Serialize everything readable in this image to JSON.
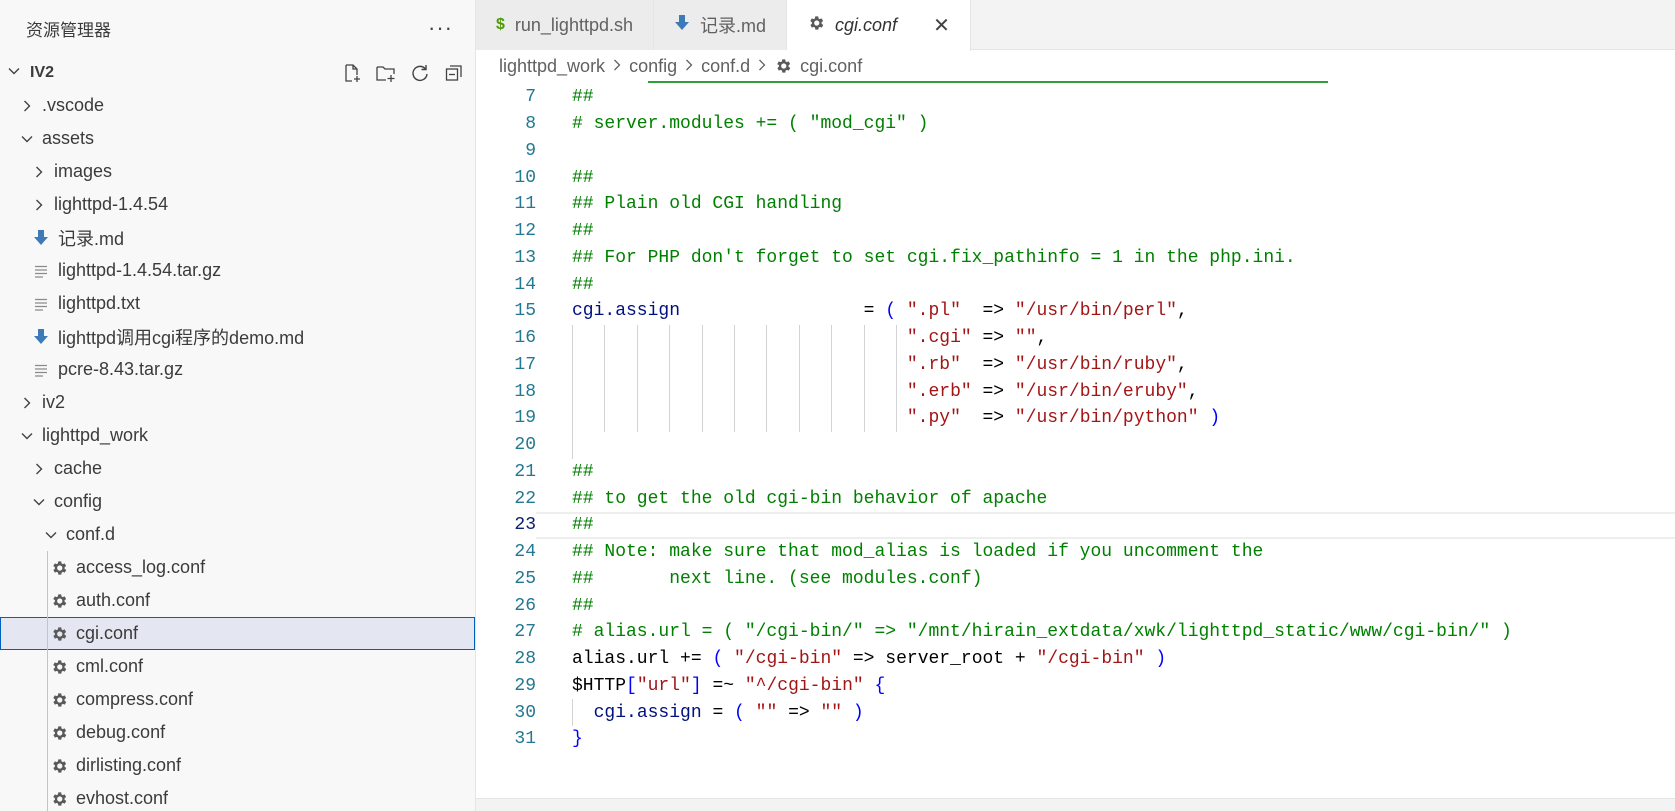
{
  "sidebar": {
    "title": "资源管理器",
    "more": "···",
    "root_label": "IV2",
    "items": [
      {
        "label": ".vscode",
        "type": "folder",
        "expanded": false,
        "depth": 1
      },
      {
        "label": "assets",
        "type": "folder",
        "expanded": true,
        "depth": 1
      },
      {
        "label": "images",
        "type": "folder",
        "expanded": false,
        "depth": 2
      },
      {
        "label": "lighttpd-1.4.54",
        "type": "folder",
        "expanded": false,
        "depth": 2
      },
      {
        "label": "记录.md",
        "type": "markdown",
        "depth": 2
      },
      {
        "label": "lighttpd-1.4.54.tar.gz",
        "type": "text",
        "depth": 2
      },
      {
        "label": "lighttpd.txt",
        "type": "text",
        "depth": 2
      },
      {
        "label": "lighttpd调用cgi程序的demo.md",
        "type": "markdown",
        "depth": 2
      },
      {
        "label": "pcre-8.43.tar.gz",
        "type": "text",
        "depth": 2
      },
      {
        "label": "iv2",
        "type": "folder",
        "expanded": false,
        "depth": 1
      },
      {
        "label": "lighttpd_work",
        "type": "folder",
        "expanded": true,
        "depth": 1
      },
      {
        "label": "cache",
        "type": "folder",
        "expanded": false,
        "depth": 2
      },
      {
        "label": "config",
        "type": "folder",
        "expanded": true,
        "depth": 2
      },
      {
        "label": "conf.d",
        "type": "folder",
        "expanded": true,
        "depth": 3
      },
      {
        "label": "access_log.conf",
        "type": "conf",
        "depth": 4
      },
      {
        "label": "auth.conf",
        "type": "conf",
        "depth": 4
      },
      {
        "label": "cgi.conf",
        "type": "conf",
        "depth": 4,
        "selected": true
      },
      {
        "label": "cml.conf",
        "type": "conf",
        "depth": 4
      },
      {
        "label": "compress.conf",
        "type": "conf",
        "depth": 4
      },
      {
        "label": "debug.conf",
        "type": "conf",
        "depth": 4
      },
      {
        "label": "dirlisting.conf",
        "type": "conf",
        "depth": 4
      },
      {
        "label": "evhost.conf",
        "type": "conf",
        "depth": 4
      }
    ]
  },
  "tabs": [
    {
      "label": "run_lighttpd.sh",
      "icon": "dollar-icon",
      "active": false
    },
    {
      "label": "记录.md",
      "icon": "markdown-icon",
      "active": false
    },
    {
      "label": "cgi.conf",
      "icon": "gear-icon",
      "active": true,
      "close": "✕"
    }
  ],
  "breadcrumb": [
    "lighttpd_work",
    "config",
    "conf.d",
    "cgi.conf"
  ],
  "editor": {
    "current_line": 23,
    "lines": [
      {
        "n": 7,
        "tokens": [
          [
            "cmt",
            "##"
          ]
        ]
      },
      {
        "n": 8,
        "tokens": [
          [
            "cmt",
            "# server.modules += ( \"mod_cgi\" )"
          ]
        ]
      },
      {
        "n": 9,
        "tokens": []
      },
      {
        "n": 10,
        "tokens": [
          [
            "cmt",
            "##"
          ]
        ]
      },
      {
        "n": 11,
        "tokens": [
          [
            "cmt",
            "## Plain old CGI handling"
          ]
        ]
      },
      {
        "n": 12,
        "tokens": [
          [
            "cmt",
            "##"
          ]
        ]
      },
      {
        "n": 13,
        "tokens": [
          [
            "cmt",
            "## For PHP don't forget to set cgi.fix_pathinfo = 1 in the php.ini."
          ]
        ]
      },
      {
        "n": 14,
        "tokens": [
          [
            "cmt",
            "##"
          ]
        ]
      },
      {
        "n": 15,
        "tokens": [
          [
            "var",
            "cgi.assign"
          ],
          [
            "txt",
            "                 = "
          ],
          [
            "kw",
            "( "
          ],
          [
            "str",
            "\".pl\""
          ],
          [
            "txt",
            "  => "
          ],
          [
            "str",
            "\"/usr/bin/perl\""
          ],
          [
            "txt",
            ","
          ]
        ]
      },
      {
        "n": 16,
        "tokens": [
          [
            "txt",
            "                               "
          ],
          [
            "str",
            "\".cgi\""
          ],
          [
            "txt",
            " => "
          ],
          [
            "str",
            "\"\""
          ],
          [
            "txt",
            ","
          ]
        ],
        "guides": true
      },
      {
        "n": 17,
        "tokens": [
          [
            "txt",
            "                               "
          ],
          [
            "str",
            "\".rb\""
          ],
          [
            "txt",
            "  => "
          ],
          [
            "str",
            "\"/usr/bin/ruby\""
          ],
          [
            "txt",
            ","
          ]
        ],
        "guides": true
      },
      {
        "n": 18,
        "tokens": [
          [
            "txt",
            "                               "
          ],
          [
            "str",
            "\".erb\""
          ],
          [
            "txt",
            " => "
          ],
          [
            "str",
            "\"/usr/bin/eruby\""
          ],
          [
            "txt",
            ","
          ]
        ],
        "guides": true
      },
      {
        "n": 19,
        "tokens": [
          [
            "txt",
            "                               "
          ],
          [
            "str",
            "\".py\""
          ],
          [
            "txt",
            "  => "
          ],
          [
            "str",
            "\"/usr/bin/python\""
          ],
          [
            "txt",
            " "
          ],
          [
            "kw",
            ")"
          ]
        ],
        "guides": true
      },
      {
        "n": 20,
        "tokens": [],
        "guide1": true
      },
      {
        "n": 21,
        "tokens": [
          [
            "cmt",
            "##"
          ]
        ]
      },
      {
        "n": 22,
        "tokens": [
          [
            "cmt",
            "## to get the old cgi-bin behavior of apache"
          ]
        ]
      },
      {
        "n": 23,
        "tokens": [
          [
            "cmt",
            "##"
          ]
        ]
      },
      {
        "n": 24,
        "tokens": [
          [
            "cmt",
            "## Note: make sure that mod_alias is loaded if you uncomment the"
          ]
        ]
      },
      {
        "n": 25,
        "tokens": [
          [
            "cmt",
            "##       next line. (see modules.conf)"
          ]
        ]
      },
      {
        "n": 26,
        "tokens": [
          [
            "cmt",
            "##"
          ]
        ]
      },
      {
        "n": 27,
        "tokens": [
          [
            "cmt",
            "# alias.url = ( \"/cgi-bin/\" => \"/mnt/hirain_extdata/xwk/lighttpd_static/www/cgi-bin/\" )"
          ]
        ]
      },
      {
        "n": 28,
        "tokens": [
          [
            "txt",
            "alias.url += "
          ],
          [
            "kw",
            "( "
          ],
          [
            "str",
            "\"/cgi-bin\""
          ],
          [
            "txt",
            " => server_root + "
          ],
          [
            "str",
            "\"/cgi-bin\""
          ],
          [
            "txt",
            " "
          ],
          [
            "kw",
            ")"
          ]
        ]
      },
      {
        "n": 29,
        "tokens": [
          [
            "txt",
            "$HTTP"
          ],
          [
            "kw",
            "["
          ],
          [
            "str",
            "\"url\""
          ],
          [
            "kw",
            "]"
          ],
          [
            "txt",
            " =~ "
          ],
          [
            "str",
            "\"^/cgi-bin\""
          ],
          [
            "txt",
            " "
          ],
          [
            "kw",
            "{"
          ]
        ]
      },
      {
        "n": 30,
        "tokens": [
          [
            "txt",
            "  "
          ],
          [
            "var",
            "cgi.assign"
          ],
          [
            "txt",
            " = "
          ],
          [
            "kw",
            "( "
          ],
          [
            "str",
            "\"\""
          ],
          [
            "txt",
            " => "
          ],
          [
            "str",
            "\"\""
          ],
          [
            "txt",
            " "
          ],
          [
            "kw",
            ")"
          ]
        ],
        "guide1": true
      },
      {
        "n": 31,
        "tokens": [
          [
            "kw",
            "}"
          ]
        ]
      }
    ]
  },
  "colors": {
    "accent": "#0060c0",
    "comment": "#008000",
    "string": "#a31515",
    "keyword": "#0000ff",
    "line_number": "#237893",
    "progress": "#2f9f38"
  }
}
